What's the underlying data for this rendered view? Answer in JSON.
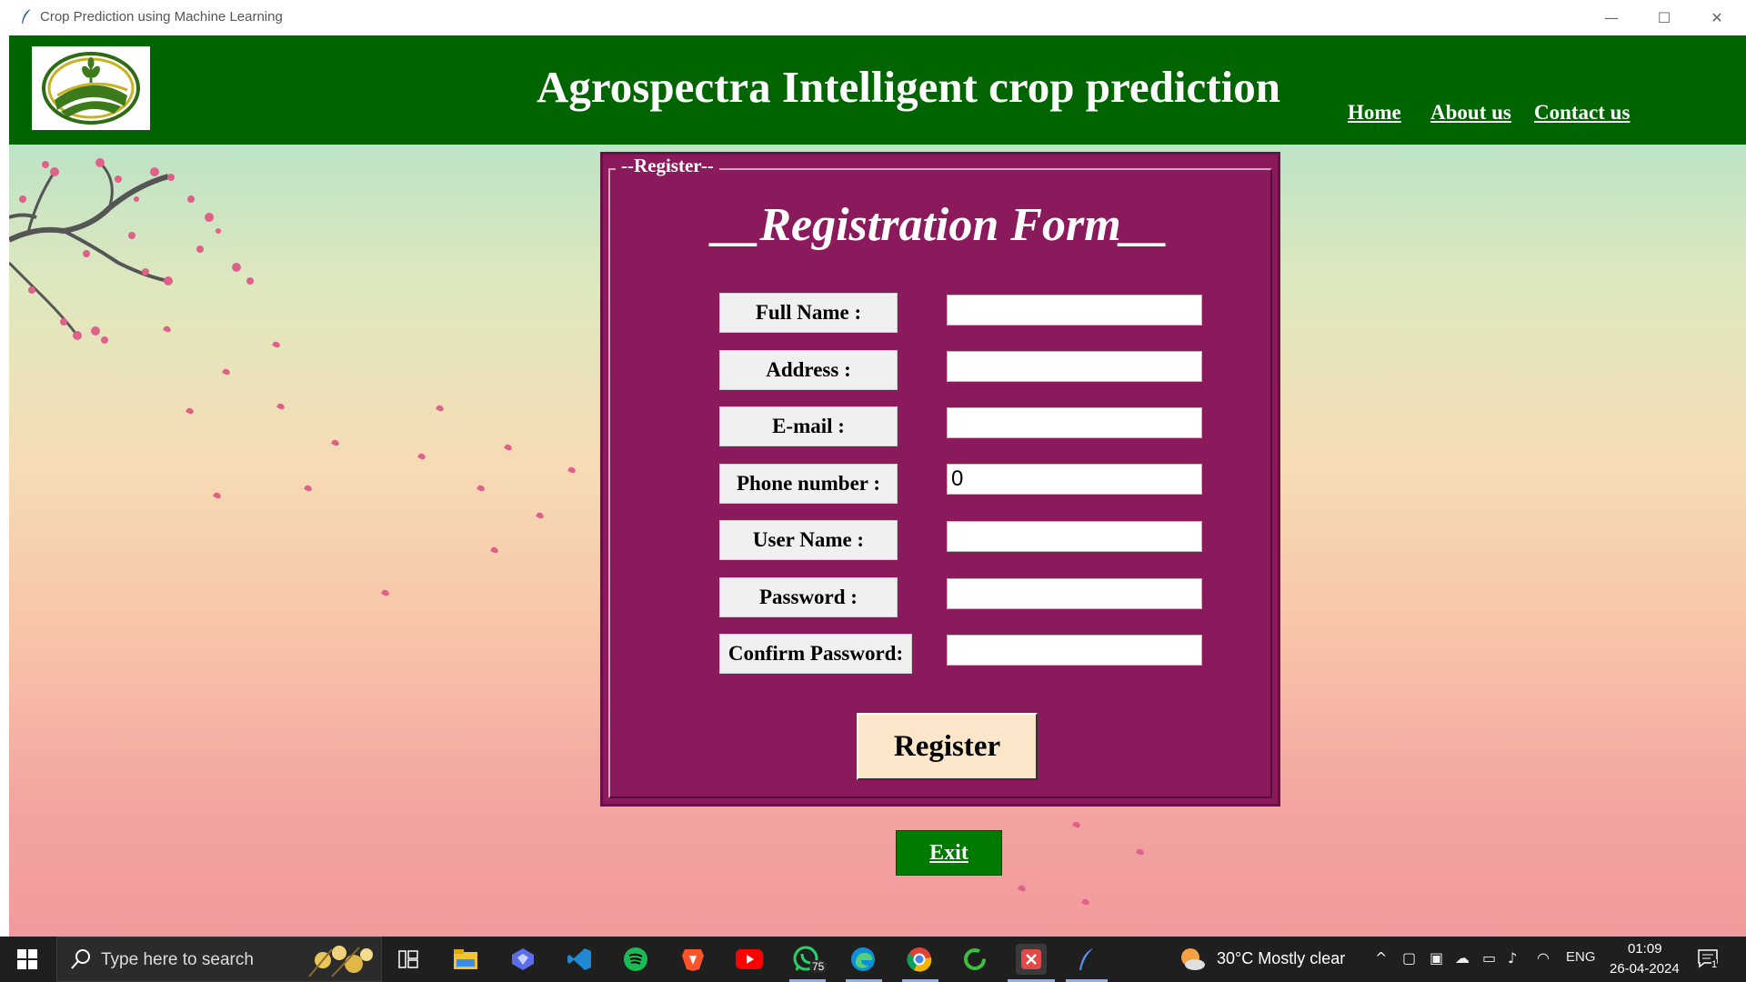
{
  "window": {
    "title": "Crop Prediction using Machine Learning",
    "minimize_glyph": "—",
    "maximize_glyph": "☐",
    "close_glyph": "✕"
  },
  "header": {
    "title": "Agrospectra Intelligent crop prediction",
    "nav": [
      "Home",
      "About us",
      "Contact us"
    ],
    "background": "#006400"
  },
  "register_panel": {
    "legend": "--Register--",
    "form_title": "__Registration Form__",
    "background": "#8b1a5c",
    "fields": [
      {
        "label": "Full Name :",
        "value": ""
      },
      {
        "label": "Address :",
        "value": ""
      },
      {
        "label": "E-mail :",
        "value": ""
      },
      {
        "label": "Phone number :",
        "value": "0"
      },
      {
        "label": "User Name :",
        "value": ""
      },
      {
        "label": "Password :",
        "value": ""
      },
      {
        "label": "Confirm Password:",
        "value": ""
      }
    ],
    "register_button": "Register"
  },
  "exit_button": "Exit",
  "taskbar": {
    "search_placeholder": "Type here to search",
    "whatsapp_badge": "75",
    "weather": "30°C  Mostly clear",
    "language": "ENG",
    "time": "01:09",
    "date": "26-04-2024",
    "notification_count": "1",
    "icons": [
      "task-view-icon",
      "file-explorer-icon",
      "copilot-icon",
      "vscode-icon",
      "spotify-icon",
      "brave-icon",
      "youtube-icon",
      "whatsapp-icon",
      "edge-icon",
      "chrome-icon",
      "refresh-app-icon",
      "snipping-tool-icon",
      "python-feather-icon"
    ]
  }
}
